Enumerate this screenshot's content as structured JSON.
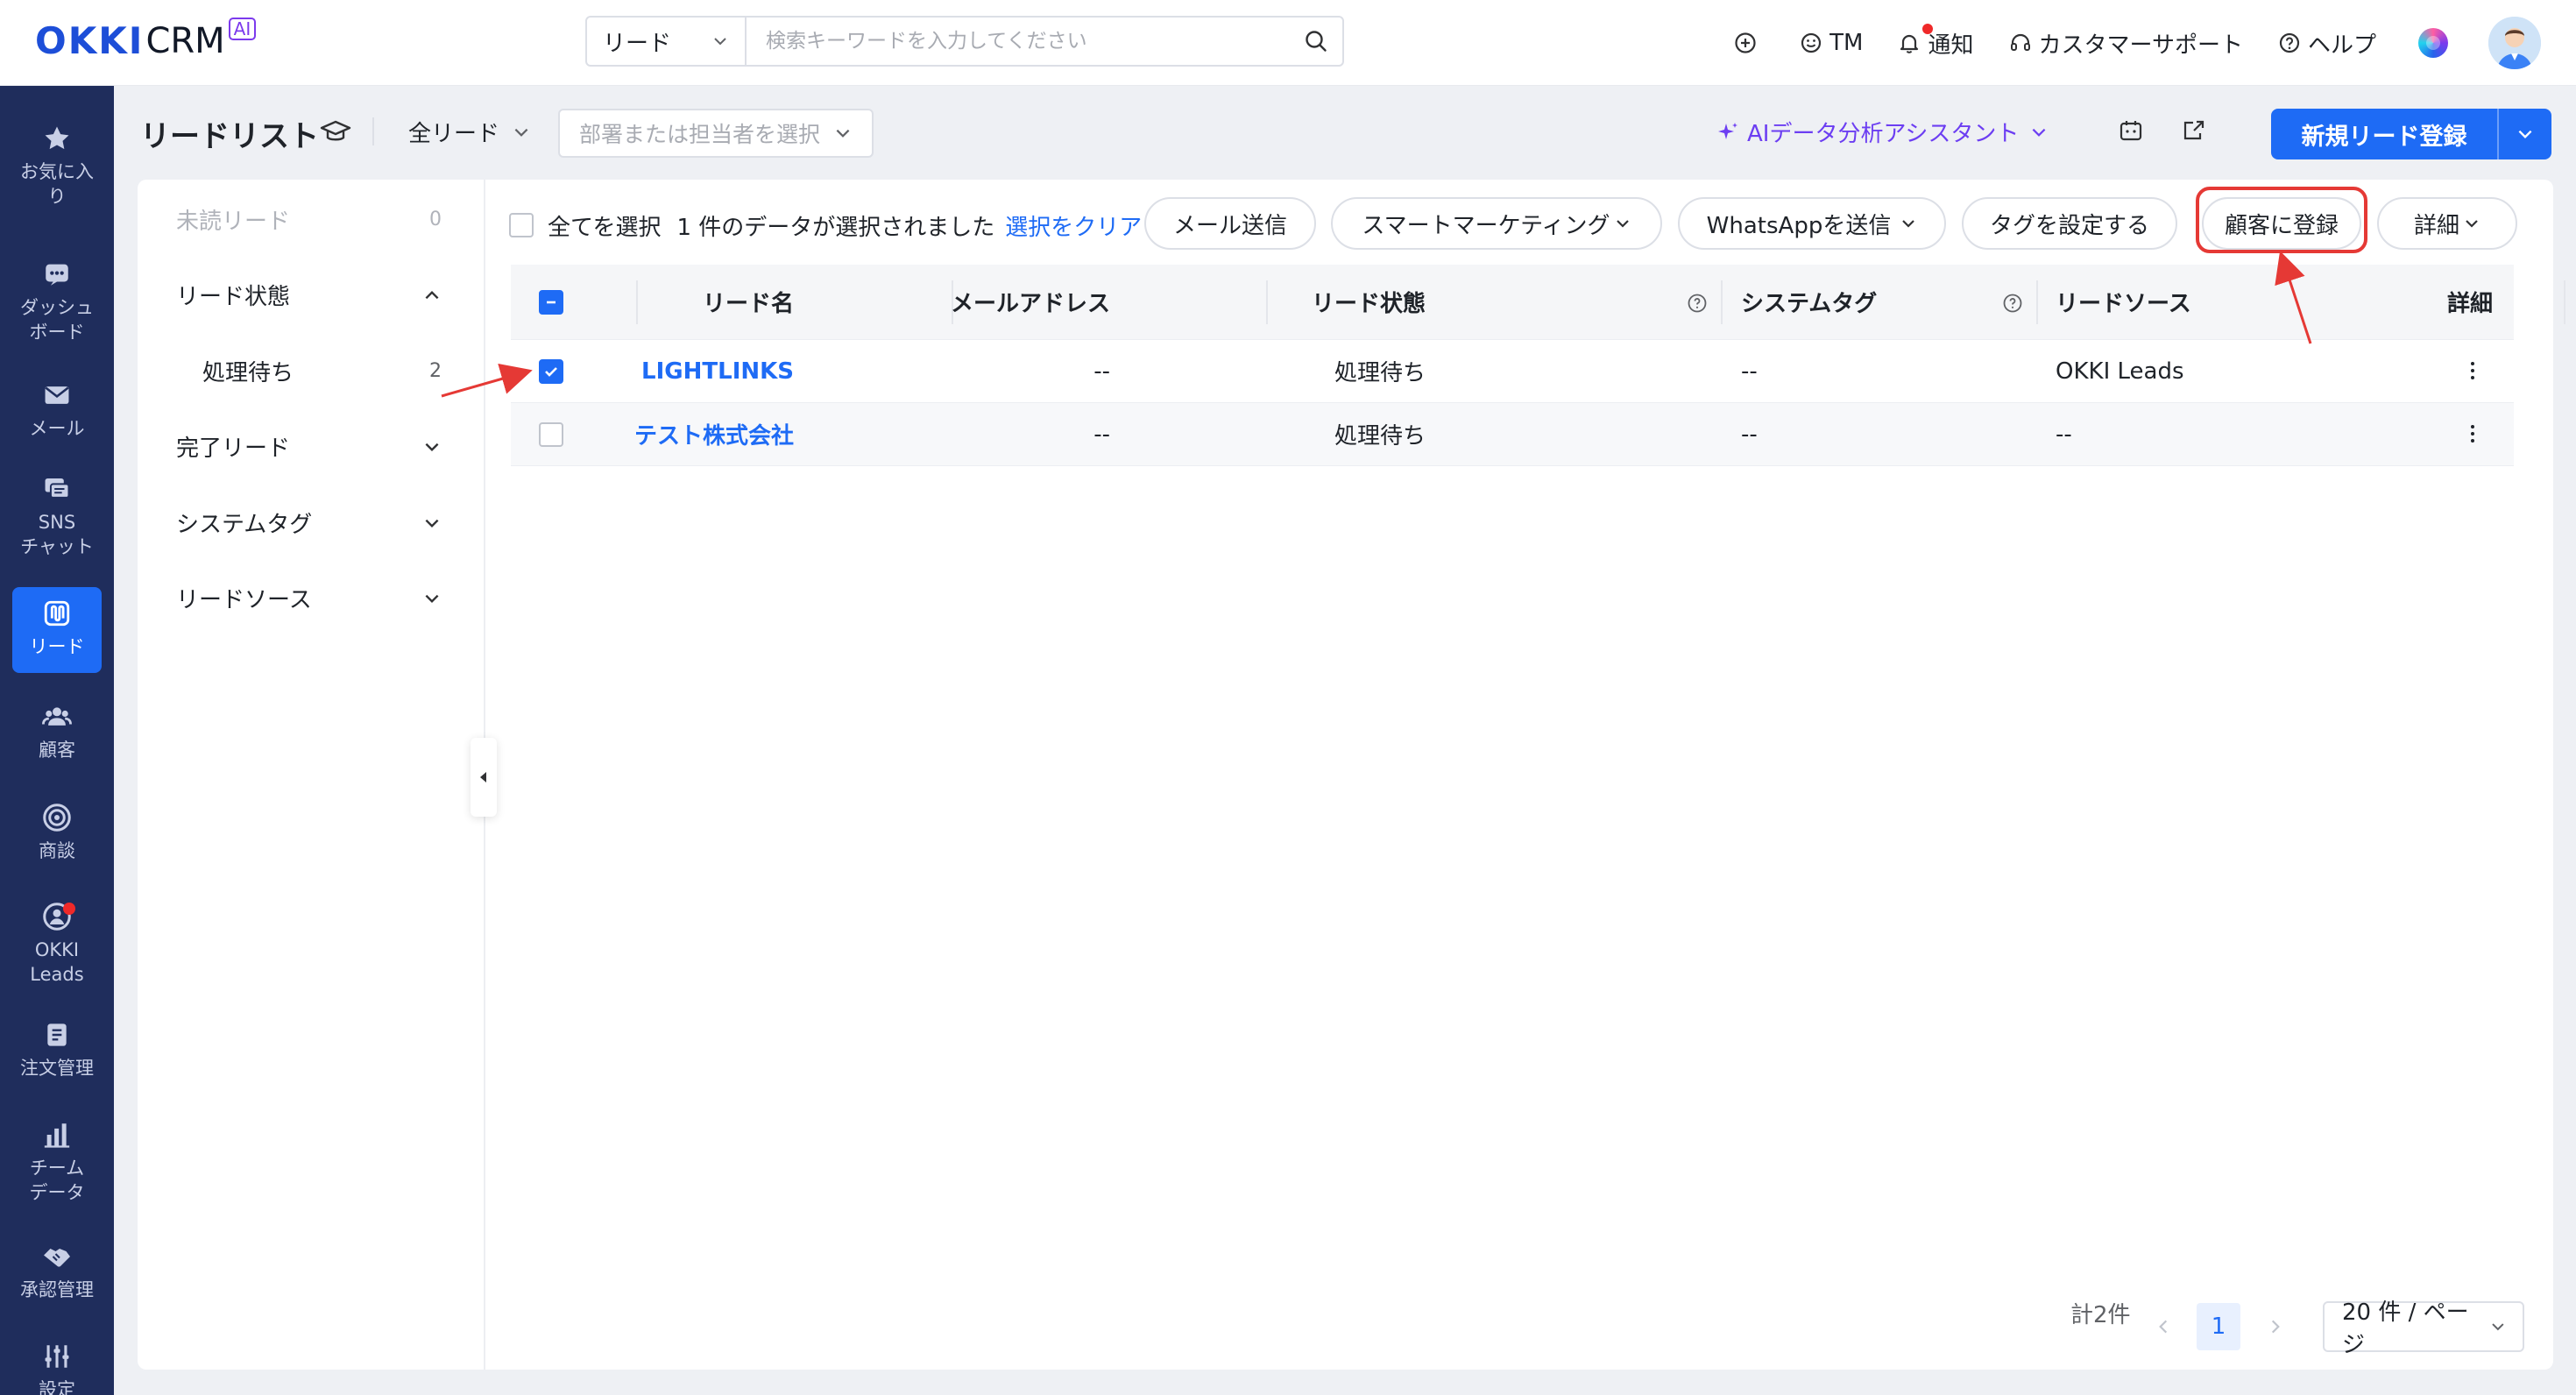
{
  "app": {
    "logo_main": "OKKI",
    "logo_crm": "CRM",
    "logo_ai": "AI"
  },
  "search": {
    "scope": "リード",
    "placeholder": "検索キーワードを入力してください"
  },
  "top_actions": {
    "tm": "TM",
    "notify": "通知",
    "support": "カスタマーサポート",
    "help": "ヘルプ"
  },
  "nav": {
    "items": [
      {
        "label": "お気に入\nり",
        "icon": "star-icon"
      },
      {
        "label": "ダッシュ\nボード",
        "icon": "dashboard-icon"
      },
      {
        "label": "メール",
        "icon": "mail-icon"
      },
      {
        "label": "SNS\nチャット",
        "icon": "chat-icon"
      },
      {
        "label": "リード",
        "icon": "leads-icon",
        "active": true
      },
      {
        "label": "顧客",
        "icon": "customers-icon"
      },
      {
        "label": "商談",
        "icon": "target-icon"
      },
      {
        "label": "OKKI\nLeads",
        "icon": "okki-leads-icon"
      },
      {
        "label": "注文管理",
        "icon": "order-icon"
      },
      {
        "label": "チーム\nデータ",
        "icon": "chart-icon"
      },
      {
        "label": "承認管理",
        "icon": "approval-icon"
      },
      {
        "label": "設定",
        "icon": "settings-icon"
      }
    ]
  },
  "header": {
    "title": "リードリスト",
    "scope": "全リード",
    "dept_placeholder": "部署または担当者を選択",
    "ai_assistant": "AIデータ分析アシスタント",
    "new_lead": "新規リード登録"
  },
  "filters": {
    "unread": {
      "label": "未読リード",
      "count": "0"
    },
    "status": {
      "label": "リード状態"
    },
    "status_pending": {
      "label": "処理待ち",
      "count": "2"
    },
    "completed": {
      "label": "完了リード"
    },
    "system_tag": {
      "label": "システムタグ"
    },
    "source": {
      "label": "リードソース"
    }
  },
  "toolbar": {
    "select_all": "全てを選択",
    "selected_text": "1 件のデータが選択されました",
    "clear_selection": "選択をクリア",
    "send_mail": "メール送信",
    "smart_marketing": "スマートマーケティング",
    "send_whatsapp": "WhatsAppを送信",
    "set_tag": "タグを設定する",
    "register_customer": "顧客に登録",
    "more": "詳細"
  },
  "table": {
    "headers": {
      "name": "リード名",
      "email": "メールアドレス",
      "status": "リード状態",
      "system_tag": "システムタグ",
      "source": "リードソース",
      "detail": "詳細"
    },
    "rows": [
      {
        "name": "LIGHTLINKS",
        "email": "--",
        "status": "処理待ち",
        "system_tag": "--",
        "source": "OKKI Leads",
        "checked": true
      },
      {
        "name": "テスト株式会社",
        "email": "--",
        "status": "処理待ち",
        "system_tag": "--",
        "source": "--",
        "checked": false
      }
    ]
  },
  "pagination": {
    "total": "計2件",
    "current_page": "1",
    "page_size": "20 件 / ページ"
  },
  "colors": {
    "primary": "#1e6bf5",
    "nav_bg": "#1f2d5c",
    "ai_purple": "#6c3ef2",
    "annotation_red": "#e53935"
  }
}
